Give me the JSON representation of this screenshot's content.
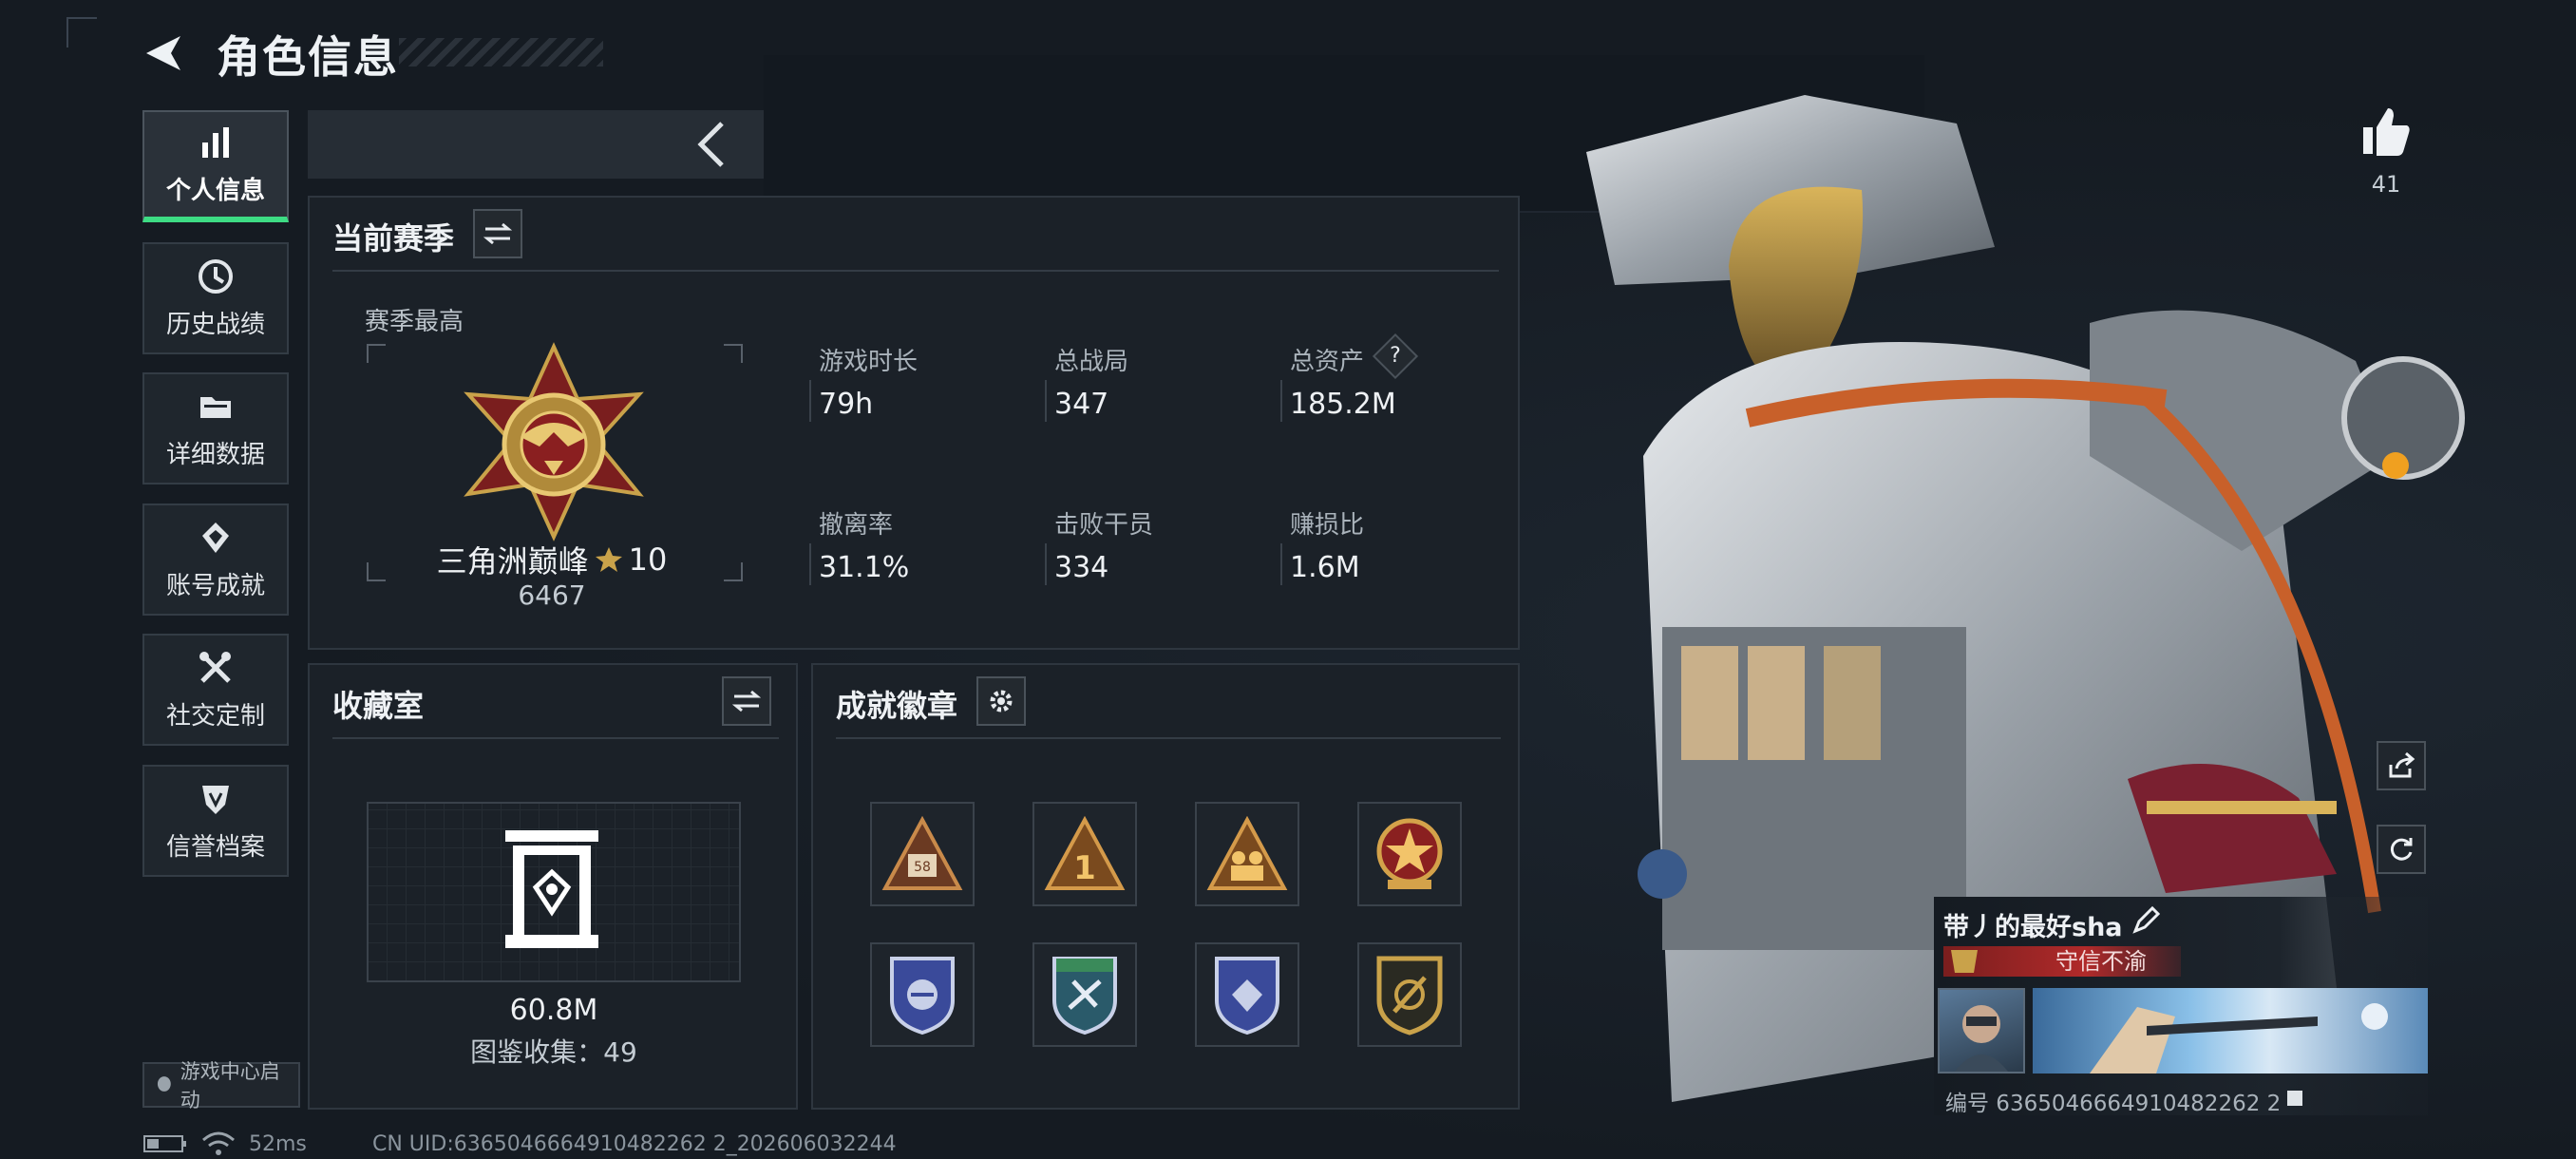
{
  "header": {
    "title": "角色信息"
  },
  "sidebar": {
    "items": [
      {
        "label": "个人信息",
        "icon": "bar-chart-icon",
        "active": true
      },
      {
        "label": "历史战绩",
        "icon": "clock-icon"
      },
      {
        "label": "详细数据",
        "icon": "folder-icon"
      },
      {
        "label": "账号成就",
        "icon": "badge-icon"
      },
      {
        "label": "社交定制",
        "icon": "tools-icon"
      },
      {
        "label": "信誉档案",
        "icon": "shield-icon"
      }
    ],
    "launch_label": "游戏中心启动"
  },
  "season": {
    "title": "当前赛季",
    "best_label": "赛季最高",
    "rank_name": "三角洲巅峰",
    "rank_stars": "10",
    "rank_score": "6467",
    "stats": [
      {
        "label": "游戏时长",
        "value": "79h"
      },
      {
        "label": "总战局",
        "value": "347"
      },
      {
        "label": "总资产",
        "value": "185.2M",
        "help": "?"
      },
      {
        "label": "撤离率",
        "value": "31.1%"
      },
      {
        "label": "击败干员",
        "value": "334"
      },
      {
        "label": "赚损比",
        "value": "1.6M"
      }
    ]
  },
  "collection": {
    "title": "收藏室",
    "value": "60.8M",
    "count_label": "图鉴收集：49"
  },
  "achievements": {
    "title": "成就徽章",
    "badges": [
      "triangle-58-badge",
      "triangle-1-badge",
      "triangle-squad-badge",
      "star-emblem-badge",
      "blue-shield-badge",
      "green-shield-badge",
      "blue-shield-diamond-badge",
      "gold-shield-badge"
    ]
  },
  "likes": {
    "count": "41"
  },
  "player": {
    "name": "带丿的最好sha",
    "tag": "守信不渝",
    "id_label": "编号 6365046664910482262 2"
  },
  "footer": {
    "ping": "52ms",
    "uid": "CN UID:6365046664910482262 2_202606032244"
  },
  "colors": {
    "accent": "#3ddc84",
    "tag_red": "#b02a2a",
    "panel": "#1b2128"
  }
}
